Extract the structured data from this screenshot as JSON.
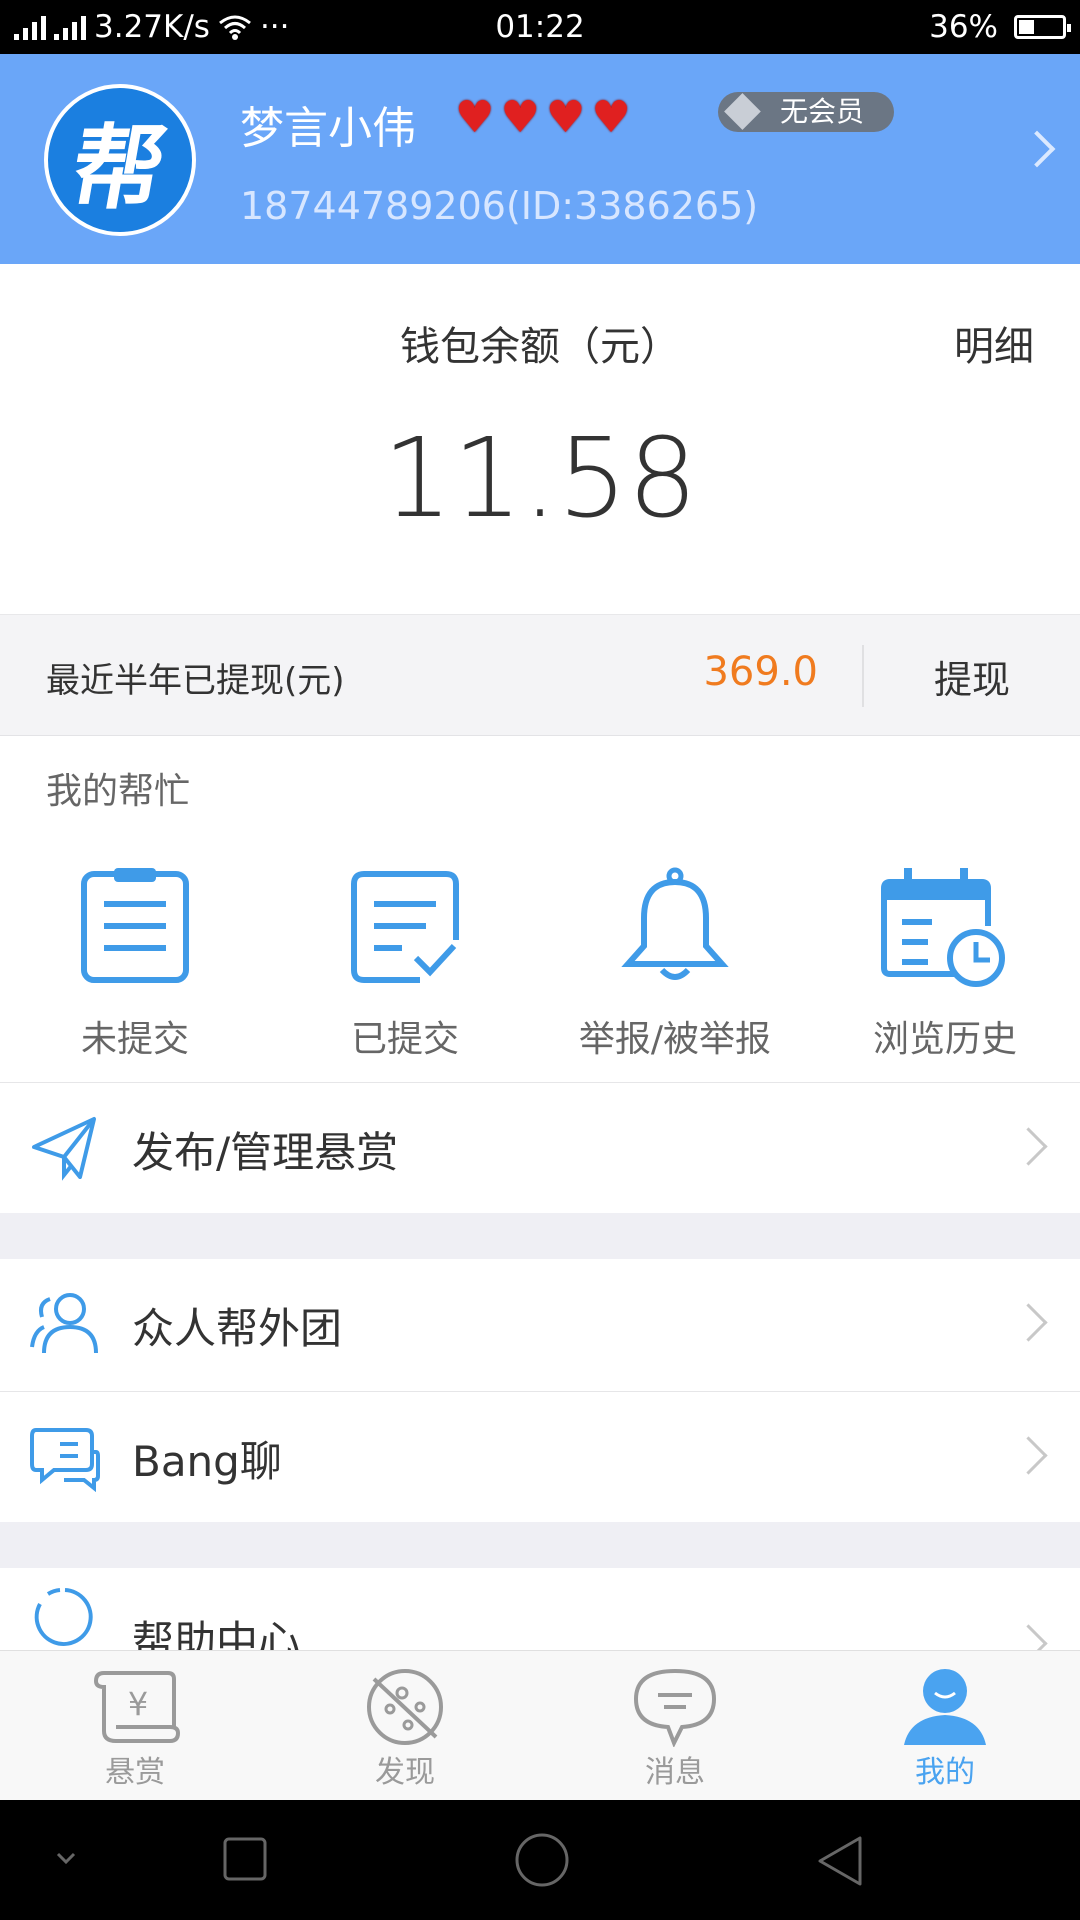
{
  "status_bar": {
    "net_speed": "3.27K/s",
    "dots": "···",
    "time": "01:22",
    "battery": "36%",
    "battery_level": 0.36
  },
  "profile": {
    "avatar_text": "帮",
    "username": "梦言小伟",
    "hearts": 4,
    "member_badge": "无会员",
    "phone_id": "18744789206(ID:3386265)"
  },
  "wallet": {
    "title": "钱包余额（元）",
    "detail_label": "明细",
    "balance": "11.58"
  },
  "withdraw": {
    "label": "最近半年已提现(元)",
    "amount": "369.0",
    "button": "提现"
  },
  "my_help": {
    "title": "我的帮忙",
    "items": [
      {
        "label": "未提交",
        "icon": "clipboard-list-icon"
      },
      {
        "label": "已提交",
        "icon": "clipboard-check-icon"
      },
      {
        "label": "举报/被举报",
        "icon": "bell-icon"
      },
      {
        "label": "浏览历史",
        "icon": "calendar-clock-icon"
      }
    ]
  },
  "menu": {
    "items": [
      {
        "label": "发布/管理悬赏",
        "icon": "paper-plane-icon"
      },
      {
        "label": "众人帮外团",
        "icon": "users-icon"
      },
      {
        "label": "Bang聊",
        "icon": "chat-bubbles-icon"
      },
      {
        "label": "帮助中心",
        "icon": "help-circle-icon"
      }
    ]
  },
  "tabs": [
    {
      "label": "悬赏",
      "icon": "scroll-yen-icon",
      "active": false
    },
    {
      "label": "发现",
      "icon": "compass-planet-icon",
      "active": false
    },
    {
      "label": "消息",
      "icon": "message-bubble-icon",
      "active": false
    },
    {
      "label": "我的",
      "icon": "person-icon",
      "active": true
    }
  ],
  "colors": {
    "header_bg": "#6aa6f8",
    "accent_blue": "#4aa3f0",
    "amount_orange": "#f07b1f"
  }
}
